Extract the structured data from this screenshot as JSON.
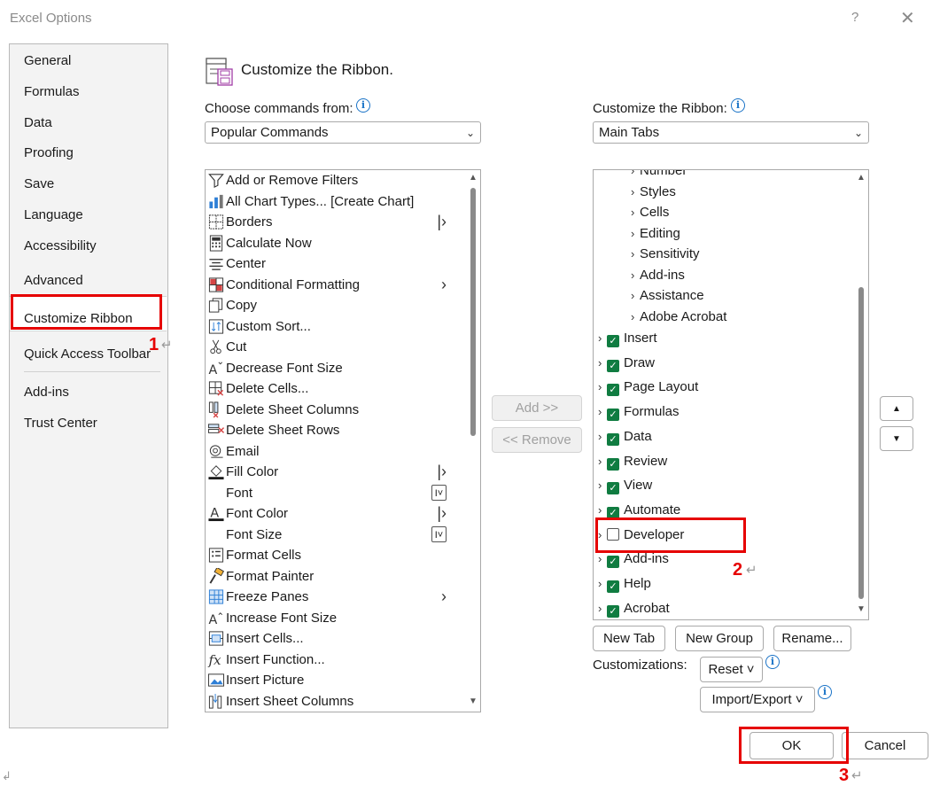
{
  "window": {
    "title": "Excel Options",
    "help_label": "?",
    "close_label": "✕"
  },
  "nav": {
    "items": [
      "General",
      "Formulas",
      "Data",
      "Proofing",
      "Save",
      "Language",
      "Accessibility",
      "Advanced",
      "Customize Ribbon",
      "Quick Access Toolbar",
      "Add-ins",
      "Trust Center"
    ],
    "selected": "Customize Ribbon"
  },
  "header": {
    "title": "Customize the Ribbon."
  },
  "left_panel": {
    "label": "Choose commands from:",
    "dropdown_value": "Popular Commands",
    "commands": [
      {
        "label": "Add or Remove Filters",
        "icon": "filter-icon",
        "sub": ""
      },
      {
        "label": "All Chart Types... [Create Chart]",
        "icon": "chart-icon",
        "sub": ""
      },
      {
        "label": "Borders",
        "icon": "borders-icon",
        "sub": "|>"
      },
      {
        "label": "Calculate Now",
        "icon": "calculator-icon",
        "sub": ""
      },
      {
        "label": "Center",
        "icon": "align-center-icon",
        "sub": ""
      },
      {
        "label": "Conditional Formatting",
        "icon": "conditional-formatting-icon",
        "sub": ">"
      },
      {
        "label": "Copy",
        "icon": "copy-icon",
        "sub": ""
      },
      {
        "label": "Custom Sort...",
        "icon": "sort-icon",
        "sub": ""
      },
      {
        "label": "Cut",
        "icon": "scissors-icon",
        "sub": ""
      },
      {
        "label": "Decrease Font Size",
        "icon": "decrease-font-icon",
        "sub": ""
      },
      {
        "label": "Delete Cells...",
        "icon": "delete-cells-icon",
        "sub": ""
      },
      {
        "label": "Delete Sheet Columns",
        "icon": "delete-columns-icon",
        "sub": ""
      },
      {
        "label": "Delete Sheet Rows",
        "icon": "delete-rows-icon",
        "sub": ""
      },
      {
        "label": "Email",
        "icon": "email-icon",
        "sub": ""
      },
      {
        "label": "Fill Color",
        "icon": "fill-color-icon",
        "sub": "|>"
      },
      {
        "label": "Font",
        "icon": "",
        "sub": "I-box"
      },
      {
        "label": "Font Color",
        "icon": "font-color-icon",
        "sub": "|>"
      },
      {
        "label": "Font Size",
        "icon": "",
        "sub": "I-box"
      },
      {
        "label": "Format Cells",
        "icon": "format-cells-icon",
        "sub": ""
      },
      {
        "label": "Format Painter",
        "icon": "format-painter-icon",
        "sub": ""
      },
      {
        "label": "Freeze Panes",
        "icon": "freeze-panes-icon",
        "sub": ">"
      },
      {
        "label": "Increase Font Size",
        "icon": "increase-font-icon",
        "sub": ""
      },
      {
        "label": "Insert Cells...",
        "icon": "insert-cells-icon",
        "sub": ""
      },
      {
        "label": "Insert Function...",
        "icon": "function-icon",
        "sub": ""
      },
      {
        "label": "Insert Picture",
        "icon": "picture-icon",
        "sub": ""
      },
      {
        "label": "Insert Sheet Columns",
        "icon": "insert-columns-icon",
        "sub": ""
      }
    ]
  },
  "middle": {
    "add_label": "Add >>",
    "remove_label": "<< Remove"
  },
  "right_panel": {
    "label": "Customize the Ribbon:",
    "dropdown_value": "Main Tabs",
    "groups": [
      "Number",
      "Styles",
      "Cells",
      "Editing",
      "Sensitivity",
      "Add-ins",
      "Assistance",
      "Adobe Acrobat"
    ],
    "tabs": [
      {
        "label": "Insert",
        "checked": true
      },
      {
        "label": "Draw",
        "checked": true
      },
      {
        "label": "Page Layout",
        "checked": true
      },
      {
        "label": "Formulas",
        "checked": true
      },
      {
        "label": "Data",
        "checked": true
      },
      {
        "label": "Review",
        "checked": true
      },
      {
        "label": "View",
        "checked": true
      },
      {
        "label": "Automate",
        "checked": true
      },
      {
        "label": "Developer",
        "checked": false
      },
      {
        "label": "Add-ins",
        "checked": true
      },
      {
        "label": "Help",
        "checked": true
      },
      {
        "label": "Acrobat",
        "checked": true
      }
    ],
    "new_tab_label": "New Tab",
    "new_group_label": "New Group",
    "rename_label": "Rename...",
    "customizations_label": "Customizations:",
    "reset_label": "Reset ˅",
    "import_export_label": "Import/Export ˅"
  },
  "footer": {
    "ok_label": "OK",
    "cancel_label": "Cancel"
  },
  "annotations": {
    "step1": "1",
    "step2": "2",
    "step3": "3",
    "color": "#e60000"
  },
  "colors": {
    "checkbox": "#107c41",
    "info": "#1a73c7"
  }
}
